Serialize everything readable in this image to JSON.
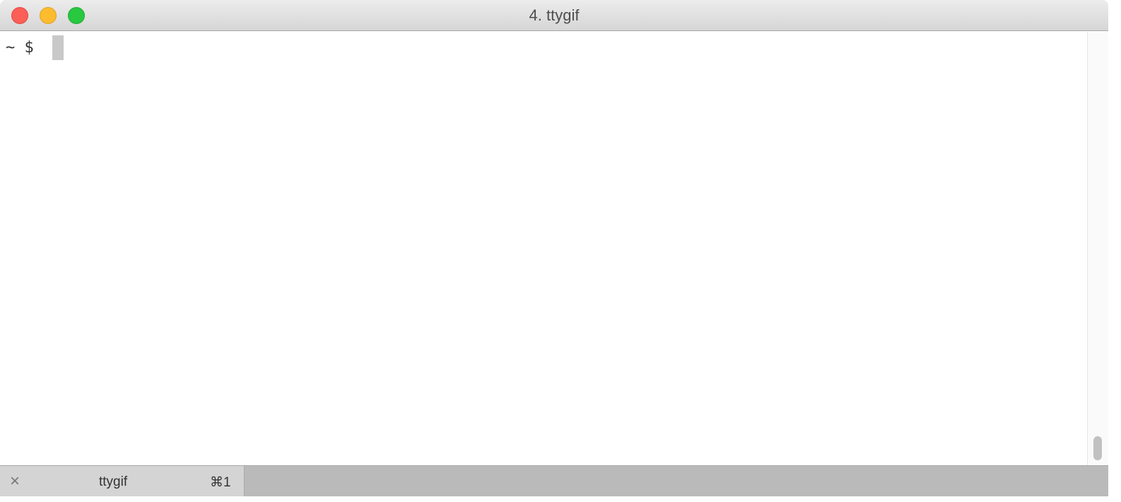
{
  "window": {
    "title": "4. ttygif"
  },
  "terminal": {
    "prompt": "~ $"
  },
  "tabs": [
    {
      "label": "ttygif",
      "shortcut": "⌘1",
      "close_icon": "×"
    }
  ]
}
